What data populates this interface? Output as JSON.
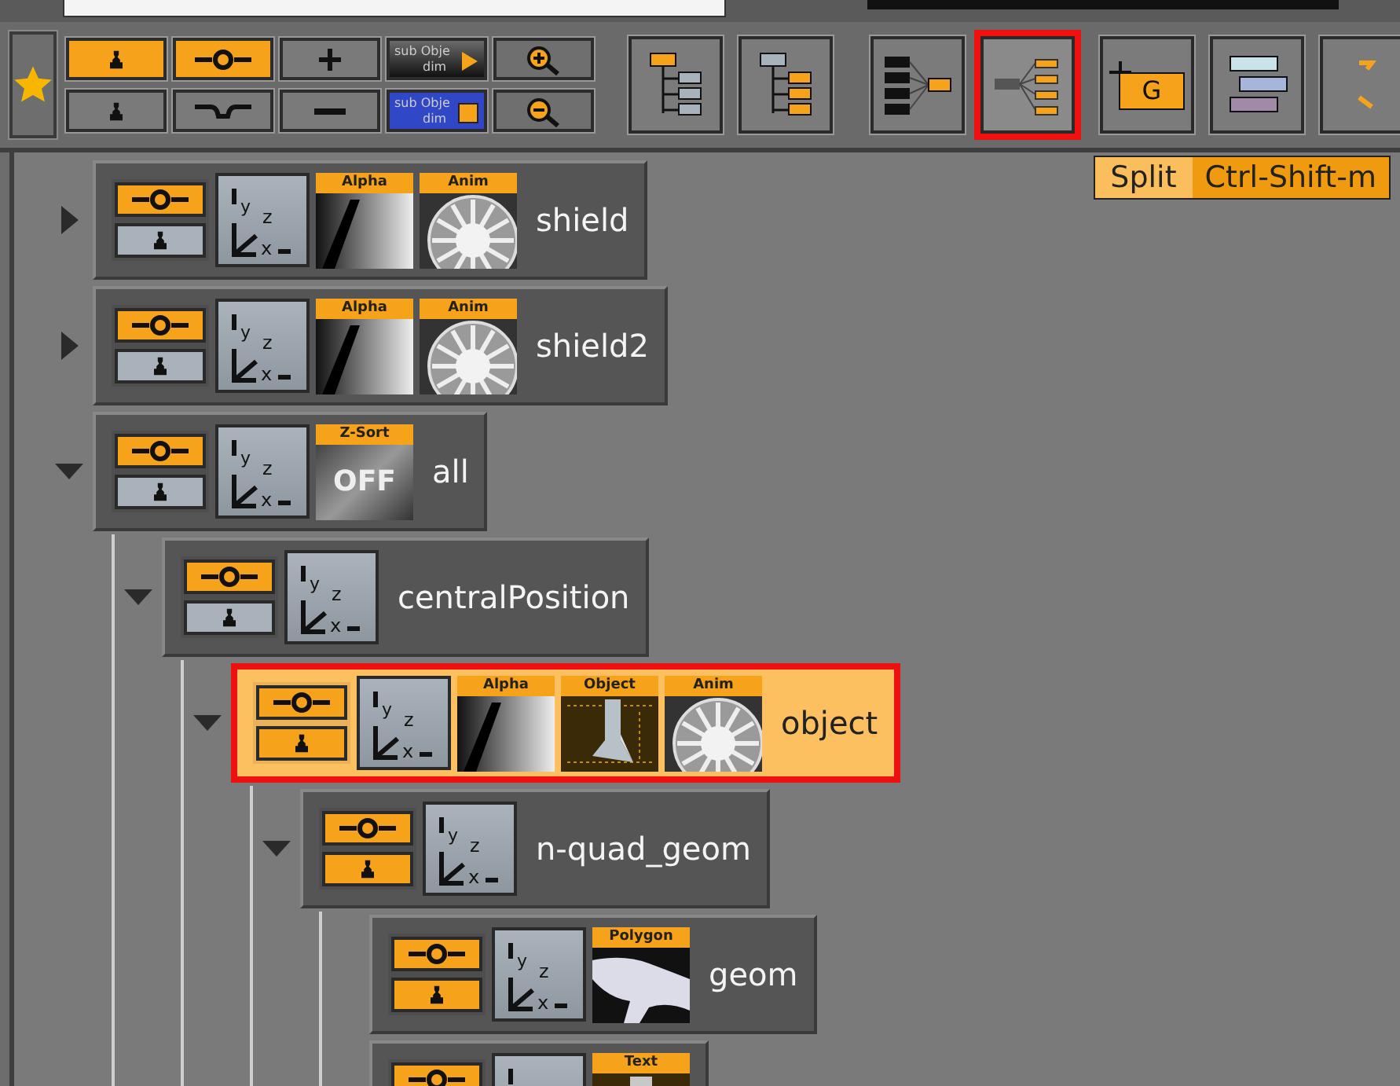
{
  "toolbar": {
    "toggles": [
      {
        "kind": "person",
        "on": true
      },
      {
        "kind": "connector",
        "on": true
      },
      {
        "kind": "plus"
      },
      {
        "kind": "sub-dark",
        "label": "sub Obje",
        "sub": "dim"
      },
      {
        "kind": "zoom-in"
      },
      {
        "kind": "person",
        "on": false
      },
      {
        "kind": "curve",
        "on": false
      },
      {
        "kind": "minus"
      },
      {
        "kind": "sub-blue",
        "label": "sub Obje",
        "sub": "dim"
      },
      {
        "kind": "zoom-out"
      }
    ],
    "buttons": [
      {
        "kind": "hierarchy",
        "selected": false
      },
      {
        "kind": "hierarchy-alt",
        "selected": false
      },
      {
        "kind": "merge",
        "selected": false
      },
      {
        "kind": "split",
        "selected": true
      },
      {
        "kind": "group",
        "label": "G",
        "selected": false
      },
      {
        "kind": "layers",
        "selected": false
      },
      {
        "kind": "partial",
        "selected": false
      }
    ]
  },
  "tooltip": {
    "name": "Split",
    "shortcut": "Ctrl-Shift-m"
  },
  "tree": [
    {
      "name": "shield",
      "expanded": false,
      "selected": false,
      "visible": true,
      "key": false,
      "axis": [
        "y",
        "z",
        "x"
      ],
      "plugins": [
        {
          "kind": "alpha",
          "label": "Alpha"
        },
        {
          "kind": "anim",
          "label": "Anim"
        }
      ]
    },
    {
      "name": "shield2",
      "expanded": false,
      "selected": false,
      "visible": true,
      "key": false,
      "axis": [
        "y",
        "z",
        "x"
      ],
      "plugins": [
        {
          "kind": "alpha",
          "label": "Alpha"
        },
        {
          "kind": "anim",
          "label": "Anim"
        }
      ]
    },
    {
      "name": "all",
      "expanded": true,
      "selected": false,
      "visible": true,
      "key": false,
      "axis": [
        "y",
        "z",
        "x"
      ],
      "plugins": [
        {
          "kind": "zsort",
          "label": "Z-Sort",
          "caption": "OFF"
        }
      ],
      "children": [
        {
          "name": "centralPosition",
          "expanded": true,
          "selected": false,
          "visible": true,
          "key": false,
          "axis": [
            "y",
            "z",
            "x"
          ],
          "children": [
            {
              "name": "object",
              "expanded": true,
              "selected": true,
              "visible": true,
              "key": true,
              "axis": [
                "y",
                "z",
                "x"
              ],
              "plugins": [
                {
                  "kind": "alpha",
                  "label": "Alpha"
                },
                {
                  "kind": "object",
                  "label": "Object"
                },
                {
                  "kind": "anim",
                  "label": "Anim"
                }
              ],
              "children": [
                {
                  "name": "n-quad_geom",
                  "expanded": true,
                  "selected": false,
                  "visible": true,
                  "key": true,
                  "axis": [
                    "y",
                    "z",
                    "x"
                  ],
                  "children": [
                    {
                      "name": "geom",
                      "selected": false,
                      "visible": true,
                      "key": true,
                      "axis": [
                        "y",
                        "z",
                        "x"
                      ],
                      "plugins": [
                        {
                          "kind": "polygon",
                          "label": "Polygon"
                        }
                      ]
                    },
                    {
                      "selected": false,
                      "visible": true,
                      "plugins": [
                        {
                          "kind": "text",
                          "label": "Text"
                        }
                      ]
                    }
                  ]
                }
              ]
            }
          ]
        }
      ]
    }
  ]
}
